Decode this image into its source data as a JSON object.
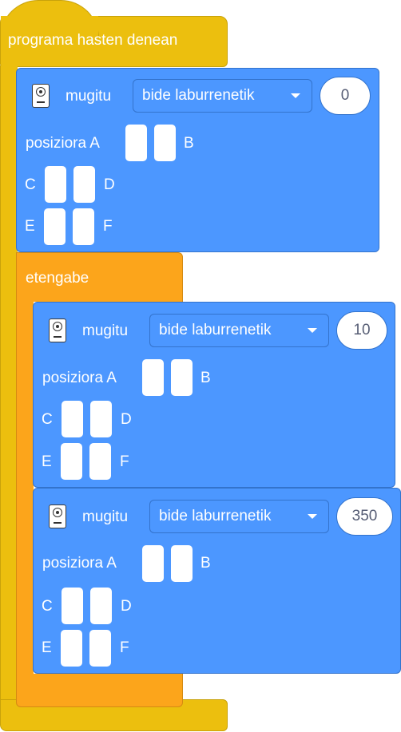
{
  "hat": {
    "label": "programa hasten denean"
  },
  "loop": {
    "label": "etengabe"
  },
  "motor_blocks": [
    {
      "label": "mugitu",
      "direction": "bide laburrenetik",
      "value": "0",
      "row1_label": "posiziora A",
      "row1_end": "B",
      "row2_start": "C",
      "row2_end": "D",
      "row3_start": "E",
      "row3_end": "F"
    },
    {
      "label": "mugitu",
      "direction": "bide laburrenetik",
      "value": "10",
      "row1_label": "posiziora A",
      "row1_end": "B",
      "row2_start": "C",
      "row2_end": "D",
      "row3_start": "E",
      "row3_end": "F"
    },
    {
      "label": "mugitu",
      "direction": "bide laburrenetik",
      "value": "350",
      "row1_label": "posiziora A",
      "row1_end": "B",
      "row2_start": "C",
      "row2_end": "D",
      "row3_start": "E",
      "row3_end": "F"
    }
  ],
  "colors": {
    "hat": "#ecbf0e",
    "control": "#fca51b",
    "motion": "#4c97ff"
  },
  "icons": {
    "motor": "motor-icon",
    "dropdown": "dropdown-arrow-icon"
  }
}
